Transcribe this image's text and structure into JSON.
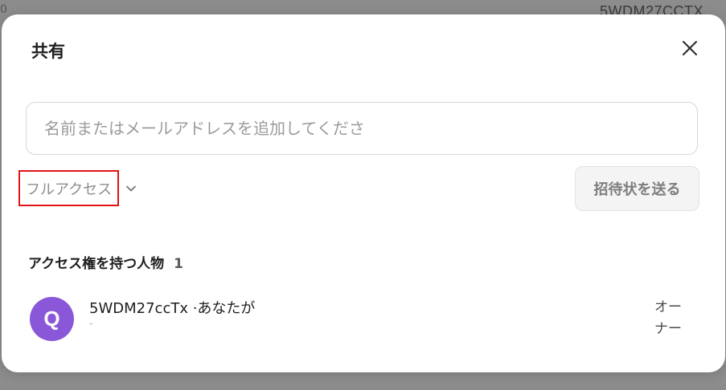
{
  "background": {
    "left_text": "0",
    "right_text": "5WDM27CCTX"
  },
  "dialog": {
    "title": "共有",
    "close_icon": "close-icon"
  },
  "invite": {
    "input_value": "",
    "input_placeholder": "名前またはメールアドレスを追加してくださ",
    "access_level": "フルアクセス",
    "dropdown_icon": "chevron-down-icon",
    "send_label": "招待状を送る"
  },
  "people": {
    "title": "アクセス権を持つ人物",
    "count": "1",
    "list": [
      {
        "avatar_letter": "Q",
        "avatar_color": "#8a57d8",
        "name": "5WDM27ccTx ·あなたが",
        "email": "-",
        "role": "オーナー"
      }
    ]
  },
  "colors": {
    "highlight": "#e01414",
    "avatar": "#8a57d8"
  }
}
